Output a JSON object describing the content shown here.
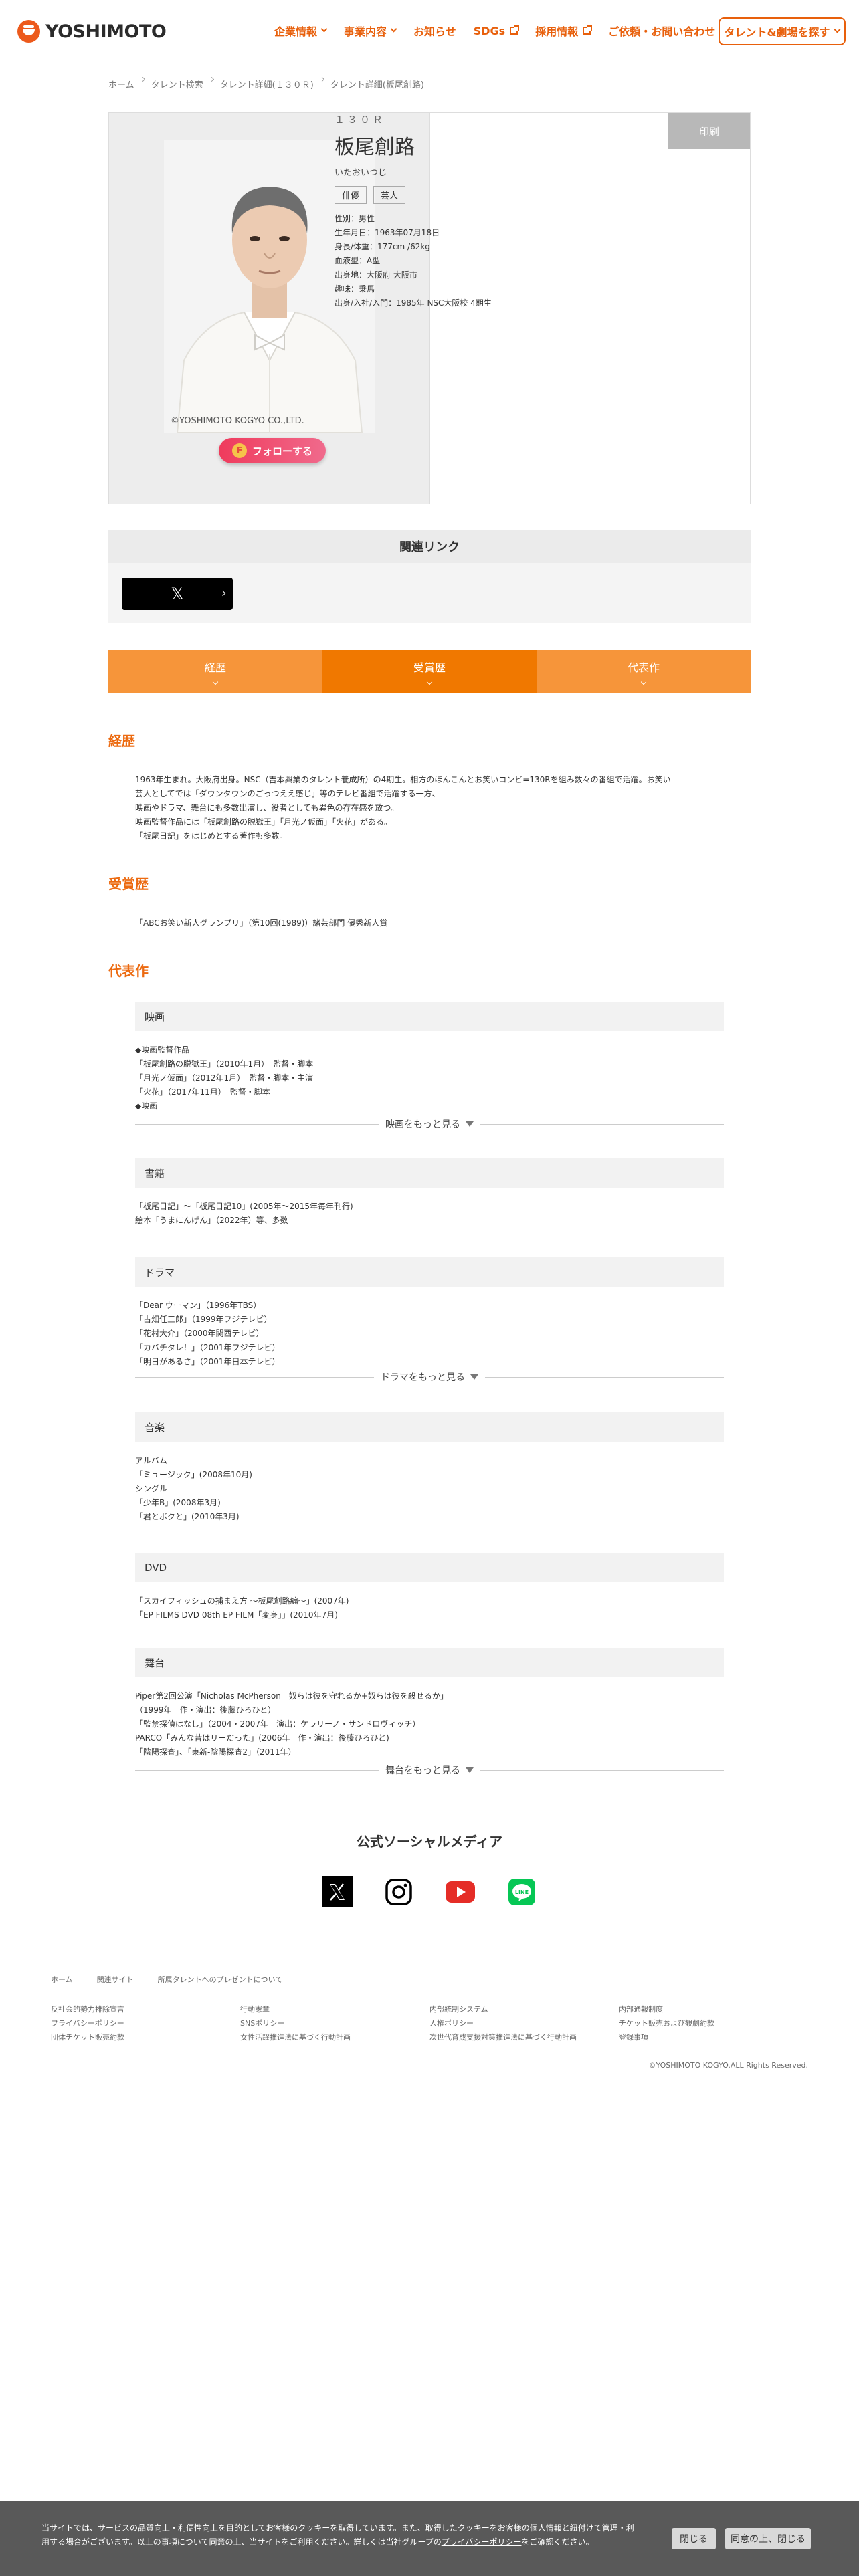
{
  "header": {
    "logo_text": "YOSHIMOTO",
    "nav": [
      {
        "label": "企業情報",
        "icon": "chevron-down-icon"
      },
      {
        "label": "事業内容",
        "icon": "chevron-down-icon"
      },
      {
        "label": "お知らせ",
        "icon": ""
      },
      {
        "label": "SDGs",
        "icon": "external-link-icon"
      },
      {
        "label": "採用情報",
        "icon": "external-link-icon"
      },
      {
        "label": "ご依頼・お問い合わせ",
        "icon": ""
      }
    ],
    "talent_search": "タレント&劇場を探す",
    "accent_color": "#e8600c"
  },
  "breadcrumb": [
    "ホーム",
    "タレント検索",
    "タレント詳細(１３０Ｒ)",
    "タレント詳細(板尾創路)"
  ],
  "profile": {
    "photo_copyright": "©YOSHIMOTO KOGYO CO.,LTD.",
    "follow_label": "フォローする",
    "print_label": "印刷",
    "group": "１３０Ｒ",
    "name": "板尾創路",
    "kana": "いたおいつじ",
    "tags": [
      "俳優",
      "芸人"
    ],
    "details": [
      "性別：男性",
      "生年月日：1963年07月18日",
      "身長/体重：177cm /62kg",
      "血液型：A型",
      "出身地：大阪府 大阪市",
      "趣味：乗馬",
      "出身/入社/入門：1985年 NSC大阪校 4期生"
    ]
  },
  "related": {
    "title": "関連リンク",
    "x_label": "𝕏"
  },
  "tabs": [
    "経歴",
    "受賞歴",
    "代表作"
  ],
  "career": {
    "title": "経歴",
    "lines": [
      "1963年生まれ。大阪府出身。NSC（吉本興業のタレント養成所）の4期生。相方のほんこんとお笑いコンビ=130Rを組み数々の番組で活躍。お笑い",
      "芸人としてでは「ダウンタウンのごっつええ感じ」等のテレビ番組で活躍する一方、",
      "映画やドラマ、舞台にも多数出演し、役者としても異色の存在感を放つ。",
      "映画監督作品には「板尾創路の脱獄王」「月光ノ仮面」「火花」がある。",
      "「板尾日記」をはじめとする著作も多数。"
    ]
  },
  "awards": {
    "title": "受賞歴",
    "lines": [
      "「ABCお笑い新人グランプリ」（第10回(1989)）諸芸部門 優秀新人賞"
    ]
  },
  "works": {
    "title": "代表作",
    "movie": {
      "head": "映画",
      "lines": [
        "◆映画監督作品",
        "「板尾創路の脱獄王」（2010年1月）　監督・脚本",
        "「月光ノ仮面」（2012年1月）　監督・脚本・主演",
        "「火花」（2017年11月）　監督・脚本",
        "◆映画"
      ],
      "more": "映画をもっと見る"
    },
    "books": {
      "head": "書籍",
      "lines": [
        "「板尾日記」～「板尾日記10」(2005年～2015年毎年刊行)",
        "絵本「うまにんげん」（2022年）等、多数"
      ]
    },
    "drama": {
      "head": "ドラマ",
      "lines": [
        "「Dear ウーマン」（1996年TBS）",
        "「古畑任三郎」（1999年フジテレビ）",
        "「花村大介」（2000年関西テレビ）",
        "「カバチタレ！」（2001年フジテレビ）",
        "「明日があるさ」（2001年日本テレビ）"
      ],
      "more": "ドラマをもっと見る"
    },
    "music": {
      "head": "音楽",
      "lines": [
        "アルバム",
        "「ミュージック」(2008年10月)",
        "シングル",
        "「少年B」(2008年3月)",
        "「君とボクと」(2010年3月)"
      ]
    },
    "dvd": {
      "head": "DVD",
      "lines": [
        "「スカイフィッシュの捕まえ方 ～板尾創路編～」(2007年)",
        "「EP FILMS DVD 08th EP FILM「変身」」(2010年7月)"
      ]
    },
    "stage": {
      "head": "舞台",
      "lines": [
        "Piper第2回公演「Nicholas McPherson　奴らは彼を守れるか+奴らは彼を殺せるか」",
        "（1999年　作・演出：後藤ひろひと）",
        "「監禁探偵はなし」（2004・2007年　演出：ケラリーノ・サンドロヴィッチ）",
        "PARCO「みんな昔はリーだった」(2006年　作・演出：後藤ひろひと)",
        "「陰陽探査」、「東新-陰陽探査2」（2011年）"
      ],
      "more": "舞台をもっと見る"
    }
  },
  "social": {
    "title": "公式ソーシャルメディア",
    "icons": [
      "x-icon",
      "instagram-icon",
      "youtube-icon",
      "line-icon"
    ]
  },
  "footer": {
    "nav": [
      "ホーム",
      "関連サイト",
      "所属タレントへのプレゼントについて"
    ],
    "cols": [
      [
        "反社会的勢力排除宣言",
        "プライバシーポリシー",
        "団体チケット販売約款"
      ],
      [
        "行動憲章",
        "SNSポリシー",
        "女性活躍推進法に基づく行動計画"
      ],
      [
        "内部統制システム",
        "人権ポリシー",
        "次世代育成支援対策推進法に基づく行動計画"
      ],
      [
        "内部通報制度",
        "チケット販売および観劇約款",
        "登録事項"
      ]
    ],
    "copyright": "©YOSHIMOTO KOGYO.ALL Rights Reserved."
  },
  "cookie": {
    "text_before": "当サイトでは、サービスの品質向上・利便性向上を目的としてお客様のクッキーを取得しています。また、取得したクッキーをお客様の個人情報と紐付けて管理・利用する場合がございます。以上の事項について同意の上、当サイトをご利用ください。詳しくは当社グループの",
    "link": "プライバシーポリシー",
    "text_after": "をご確認ください。",
    "close": "閉じる",
    "agree": "同意の上、閉じる"
  }
}
